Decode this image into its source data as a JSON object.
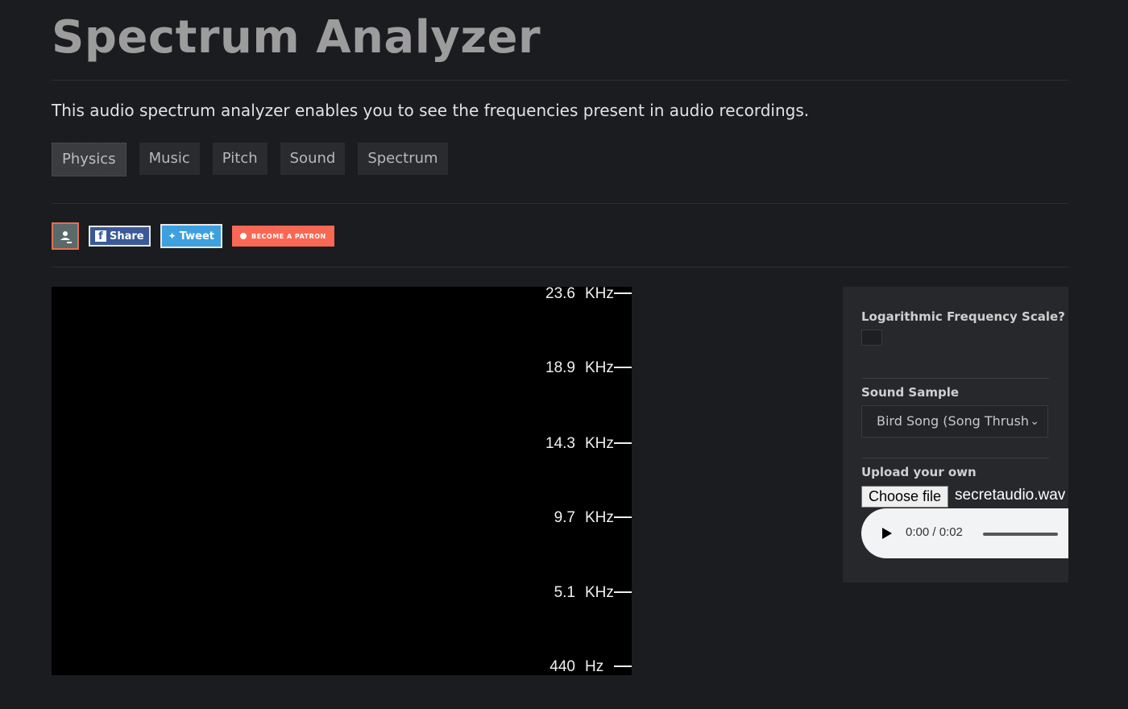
{
  "page": {
    "title": "Spectrum Analyzer",
    "description": "This audio spectrum analyzer enables you to see the frequencies present in audio recordings."
  },
  "tags": [
    "Physics",
    "Music",
    "Pitch",
    "Sound",
    "Spectrum"
  ],
  "social": {
    "share_label": "Share",
    "tweet_label": "Tweet",
    "patron_label": "BECOME A PATRON"
  },
  "frequency_axis": {
    "labels": [
      {
        "value": "23.6",
        "unit": "KHz"
      },
      {
        "value": "18.9",
        "unit": "KHz"
      },
      {
        "value": "14.3",
        "unit": "KHz"
      },
      {
        "value": "9.7",
        "unit": "KHz"
      },
      {
        "value": "5.1",
        "unit": "KHz"
      },
      {
        "value": "440",
        "unit": "Hz"
      }
    ]
  },
  "controls": {
    "log_scale_label": "Logarithmic Frequency Scale?",
    "log_scale_checked": false,
    "sound_sample_label": "Sound Sample",
    "sound_sample_value": "Bird Song (Song Thrush",
    "upload_label": "Upload your own",
    "choose_file_label": "Choose file",
    "file_name": "secretaudio.wav",
    "audio_time": "0:00 / 0:02"
  }
}
